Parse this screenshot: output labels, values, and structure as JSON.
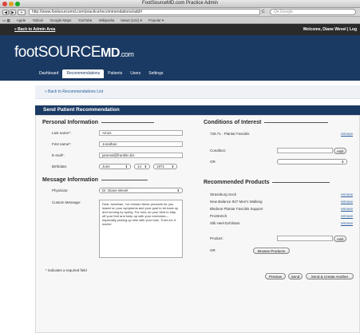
{
  "window": {
    "title": "FootSourceMD.com Practice Admin"
  },
  "browser": {
    "url": "http://www.footsourcemd.com/practice/recommendations/add#",
    "search_placeholder": "Q▾ Google",
    "bookmarks": [
      "Apple",
      "Yahoo!",
      "Google Maps",
      "YouTube",
      "Wikipedia",
      "News (121) ▾",
      "Popular ▾"
    ]
  },
  "topbar": {
    "back_link": "« Back to Admin Area",
    "welcome": "Welcome, Diane Wevel | Log"
  },
  "logo": {
    "foot": "foot",
    "source": "SOURCE",
    "md": "MD",
    "com": ".com"
  },
  "tabs": [
    "Dashboard",
    "Recommendations",
    "Patients",
    "Users",
    "Settings"
  ],
  "crumb": "« Back to Recommendations List",
  "section_title": "Send Patient Recommendation",
  "personal": {
    "heading": "Personal Information",
    "last_name_label": "Last name*:",
    "last_name": "Amos",
    "first_name_label": "First name*:",
    "first_name": "Jonathan",
    "email_label": "E-mail*:",
    "email": "jamesd@franklin.biz",
    "birthdate_label": "Birthdate:",
    "birth_month": "June",
    "birth_day": "14",
    "birth_year": "1971"
  },
  "message": {
    "heading": "Message Information",
    "physician_label": "Physician:",
    "physician": "Dr. Diane Wevel",
    "custom_label": "Custom Message:",
    "custom_text": "Dear Jonathan, I've chosen these products for you based on your symptoms and your goal to be back up and running by spring. For now, do your best to stay off your feet and keep up with your exercises—especially picking up mini with your toes. Trust me it works!"
  },
  "required_note": "* indicates a required field",
  "conditions": {
    "heading": "Conditions of Interest",
    "items": [
      {
        "name": "728.71 - Plantar Fasciitis",
        "remove": "remove"
      }
    ],
    "condition_label": "Condition:",
    "add_label": "Add",
    "or_label": "OR"
  },
  "products": {
    "heading": "Recommended Products",
    "items": [
      {
        "name": "Strassburg Sock",
        "remove": "remove"
      },
      {
        "name": "New Balance 927 Men's Walking",
        "remove": "remove"
      },
      {
        "name": "Bledsoe Plantar Fasciitis Support",
        "remove": "remove"
      },
      {
        "name": "ProStretch",
        "remove": "remove"
      },
      {
        "name": "Silk Heel Exfoliator",
        "remove": "remove"
      }
    ],
    "product_label": "Product:",
    "add_label": "Add",
    "or_label": "OR",
    "browse_label": "Browse Products"
  },
  "actions": {
    "preview": "Preview",
    "send": "Send",
    "send_create": "Send & Create Another"
  },
  "colors": {
    "brand_navy": "#1a3a64",
    "link_blue": "#2b5f9e"
  }
}
